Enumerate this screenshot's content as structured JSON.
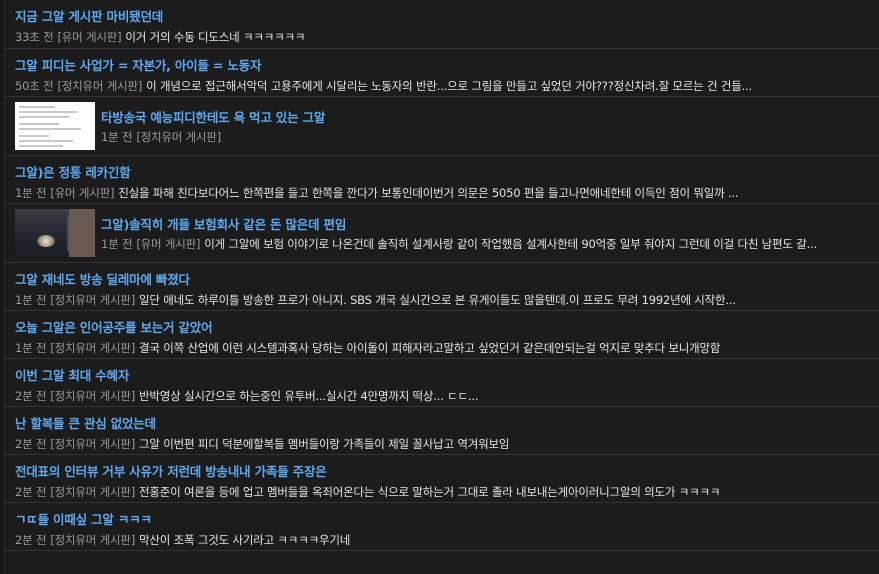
{
  "posts": [
    {
      "title": "지금 그알 게시판 마비됐던데",
      "time": "33초 전",
      "board": "[유머 게시판]",
      "excerpt": "이거 거의 수동 디도스네 ㅋㅋㅋㅋㅋㅋ"
    },
    {
      "title": "그알 피디는 사업가 = 자본가, 아이돌 = 노동자",
      "time": "50초 전",
      "board": "[정치유머 게시판]",
      "excerpt": "이 개념으로 접근해서악덕 고용주에게 시달리는 노동자의 반란...으로 그림을 만들고 싶었던 거야???정신차려.잘 모르는 건 건들..."
    },
    {
      "title": "타방송국 예능피디한테도 욕 먹고 있는 그알",
      "time": "1분 전",
      "board": "[정치유머 게시판]",
      "excerpt": "",
      "thumbnail": "document-screenshot-thumbnail"
    },
    {
      "title": "그알)은 정통 레카긴함",
      "time": "1분 전",
      "board": "[유머 게시판]",
      "excerpt": "진실을 파해 친다보다어느 한쪽편을 들고 한쪽을 깐다가 보통인데이번거 의문은 5050 편을 들고나면애네한테 이득인 점이 뭐일까 ..."
    },
    {
      "title": "그알)솔직히 개들 보험회사 같은 돈 많은데 편임",
      "time": "1분 전",
      "board": "[유머 게시판]",
      "excerpt": "이게 그알에 보험 이야기로 나온건데 솔직히 설계사랑 같이 작업했음 설계사한테 90억중 일부 줘야지 그런데 이걸 다친 남편도 갈...",
      "thumbnail": "dark-photo-thumbnail"
    },
    {
      "title": "그알 재네도 방송 딜레마에 빠졌다",
      "time": "1분 전",
      "board": "[정치유머 게시판]",
      "excerpt": "일단 애네도 하루이틀 방송한 프로가 아니지. SBS 개국 실시간으로 본 유게이들도 많을텐데.이 프로도 무려 1992년에 시작한..."
    },
    {
      "title": "오늘 그알은 인어공주를 보는거 같았어",
      "time": "1분 전",
      "board": "[정치유머 게시판]",
      "excerpt": "결국 이쪽 산업에 이런 시스템과혹사 당하는 아이돌이 피해자라고말하고 싶었던거 같은데안되는걸 억지로 맞추다 보니개망함"
    },
    {
      "title": "이번 그알 최대 수혜자",
      "time": "2분 전",
      "board": "[정치유머 게시판]",
      "excerpt": "반박영상 실시간으로 하는중인 유투버...실시간 4만명까지 떡상... ㄷㄷ..."
    },
    {
      "title": "난 할복들 큰 관심 없었는데",
      "time": "2분 전",
      "board": "[정치유머 게시판]",
      "excerpt": "그알 이번편 피디 덕분에할복들 멤버들이랑 가족들이 제일 꼴사납고 역겨워보임"
    },
    {
      "title": "전대표의 인터뷰 거부 사유가 저런데 방송내내 가족들 주장은",
      "time": "2분 전",
      "board": "[정치유머 게시판]",
      "excerpt": "전홍준이 여론을 등에 업고 멤버들을 옥죄어온다는 식으로 말하는거 그대로 졸라 내보내는게아이러니그알의 의도가 ㅋㅋㅋㅋ"
    },
    {
      "title": "ㄱㄸ들 이때싶 그알 ㅋㅋㅋ",
      "time": "2분 전",
      "board": "[정치유머 게시판]",
      "excerpt": "막산이 조폭 그것도 사기라고 ㅋㅋㅋㅋ우기네"
    }
  ],
  "colors": {
    "background": "#1c1c1c",
    "title": "#5ea9ef",
    "meta": "#9a9a9a",
    "excerpt": "#e6e6e6",
    "divider": "#343434"
  }
}
